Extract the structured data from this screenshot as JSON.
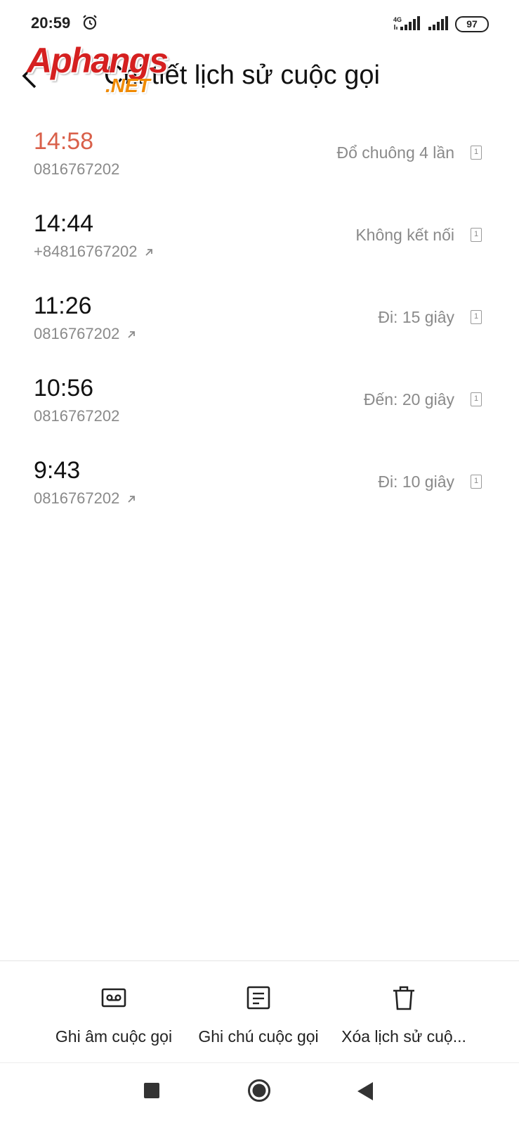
{
  "status_bar": {
    "time": "20:59",
    "network_label": "4G",
    "battery": "97"
  },
  "header": {
    "title": "Chi tiết lịch sử cuộc gọi",
    "watermark_main": "Aphangs",
    "watermark_sub": ".NET",
    "back_icon": "chevron-left-icon"
  },
  "calls": [
    {
      "time": "14:58",
      "number": "0816767202",
      "status": "Đổ chuông 4 lần",
      "sim": "1",
      "missed": true,
      "outgoing": false
    },
    {
      "time": "14:44",
      "number": "+84816767202",
      "status": "Không kết nối",
      "sim": "1",
      "missed": false,
      "outgoing": true
    },
    {
      "time": "11:26",
      "number": "0816767202",
      "status": "Đi: 15 giây",
      "sim": "1",
      "missed": false,
      "outgoing": true
    },
    {
      "time": "10:56",
      "number": "0816767202",
      "status": "Đến: 20 giây",
      "sim": "1",
      "missed": false,
      "outgoing": false
    },
    {
      "time": "9:43",
      "number": "0816767202",
      "status": "Đi: 10 giây",
      "sim": "1",
      "missed": false,
      "outgoing": true
    }
  ],
  "actions": {
    "record_label": "Ghi âm cuộc gọi",
    "note_label": "Ghi chú cuộc gọi",
    "delete_label": "Xóa lịch sử cuộ..."
  },
  "colors": {
    "missed": "#d9604a",
    "secondary_text": "#8a8a8a",
    "primary_text": "#111111"
  }
}
